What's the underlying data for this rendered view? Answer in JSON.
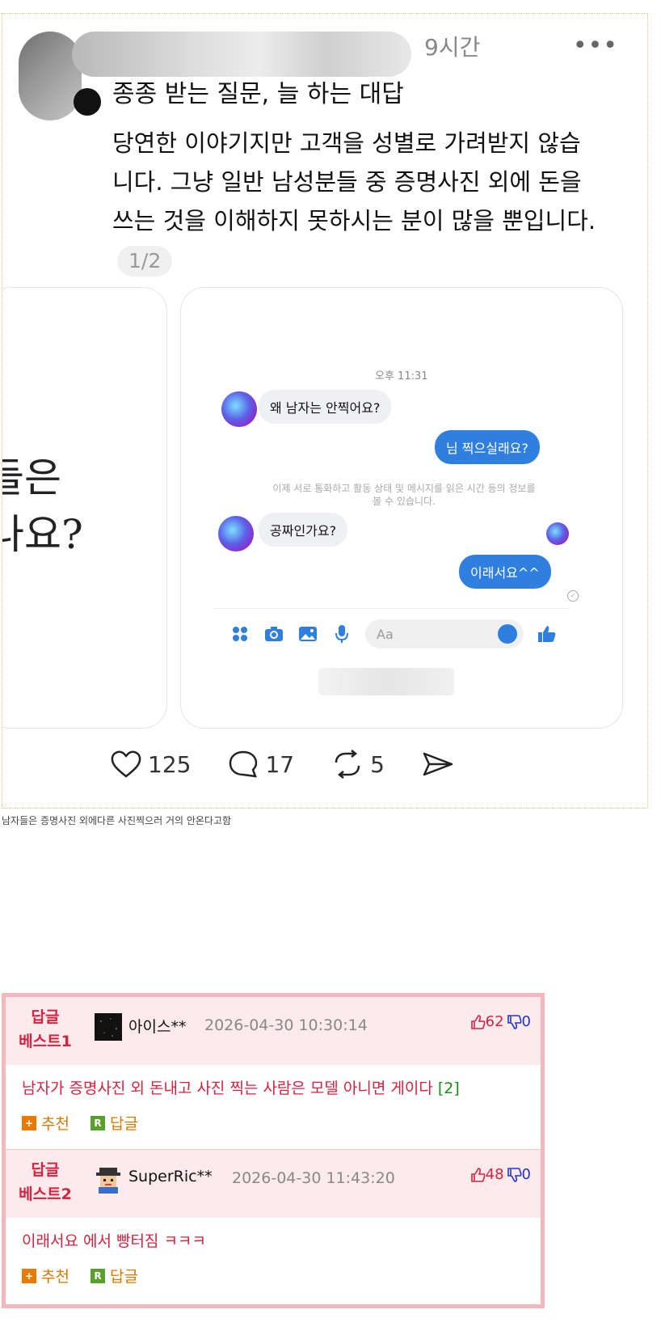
{
  "post": {
    "timestamp": "9시간",
    "more": "•••",
    "title": "종종 받는 질문, 늘 하는 대답",
    "body": "당연한 이야기지만 고객을 성별로 가려받지 않습니다. 그냥 일반 남성분들 중 증명사진 외에 돈을 쓰는 것을 이해하지 못하시는 분이 많을 뿐입니다.",
    "pager": "1/2",
    "left_image_text": [
      "들은",
      "나요?"
    ],
    "chat": {
      "time": "오후 11:31",
      "in1": "왜 남자는 안찍어요?",
      "out1": "님 찍으실래요?",
      "notice": "이제 서로 통화하고 활동 상태 및 메시지를 읽은 시간 등의 정보를 볼 수 있습니다.",
      "in2": "공짜인가요?",
      "out2": "이래서요^^",
      "input_placeholder": "Aa"
    },
    "stats": {
      "likes": "125",
      "comments": "17",
      "reposts": "5"
    }
  },
  "caption": "남자들은 증명사진 외에다른 사진찍으러 거의 안온다고함",
  "comments": [
    {
      "rank_line1": "답글",
      "rank_line2": "베스트1",
      "user": "아이스**",
      "date": "2026-04-30 10:30:14",
      "up": "62",
      "down": "0",
      "text": "남자가 증명사진 외 돈내고 사진 찍는 사람은 모델 아니면 게이다",
      "reply_count": "[2]",
      "like_label": "추천",
      "reply_label": "답글"
    },
    {
      "rank_line1": "답글",
      "rank_line2": "베스트2",
      "user": "SuperRic**",
      "date": "2026-04-30 11:43:20",
      "up": "48",
      "down": "0",
      "text": "이래서요 에서 빵터짐 ㅋㅋㅋ",
      "reply_count": "",
      "like_label": "추천",
      "reply_label": "답글"
    }
  ]
}
